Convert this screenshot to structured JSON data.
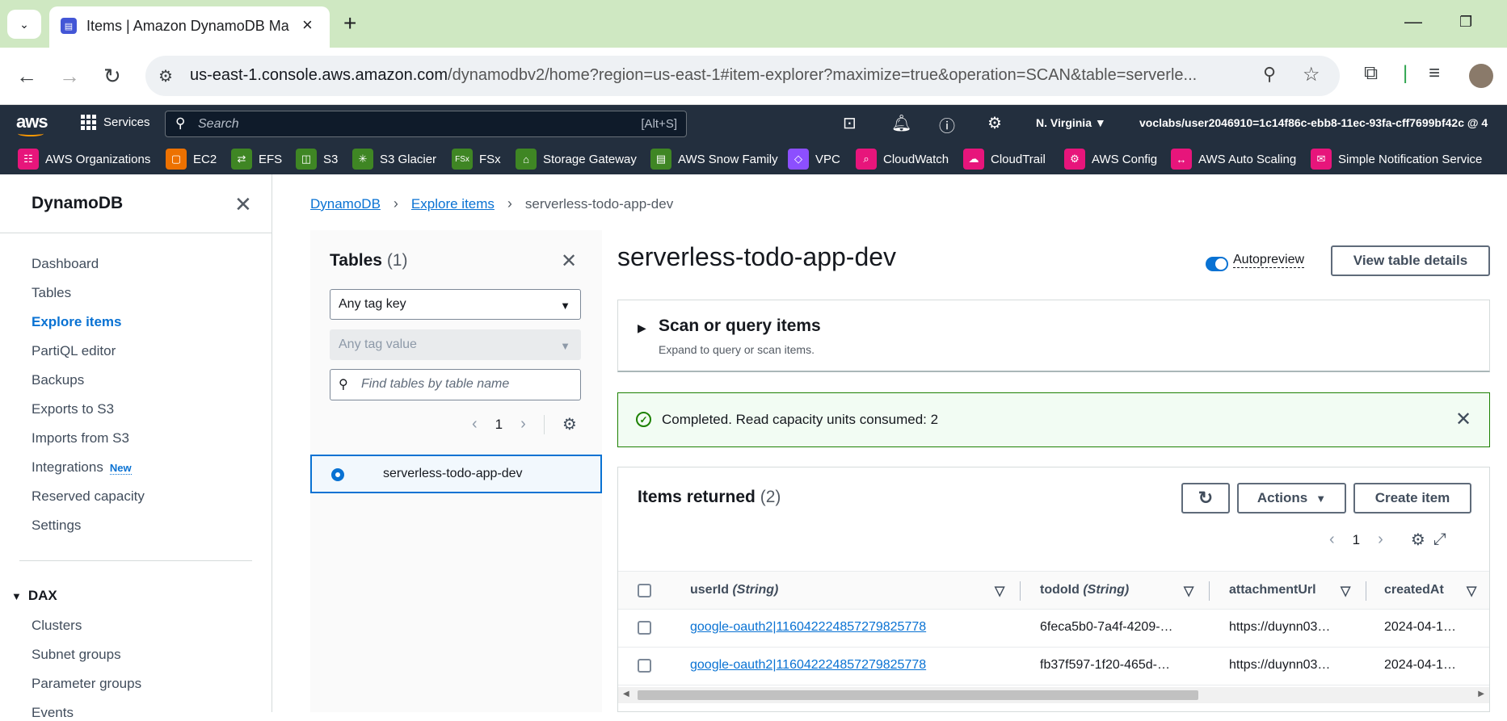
{
  "browser": {
    "tab_title": "Items | Amazon DynamoDB Ma",
    "url_host": "us-east-1.console.aws.amazon.com",
    "url_path": "/dynamodbv2/home?region=us-east-1#item-explorer?maximize=true&operation=SCAN&table=serverle..."
  },
  "aws_nav": {
    "services_label": "Services",
    "search_placeholder": "Search",
    "search_shortcut": "[Alt+S]",
    "region": "N. Virginia ▼",
    "account": "voclabs/user2046910=1c14f86c-ebb8-11ec-93fa-cff7699bf42c @ 4"
  },
  "favorites": [
    {
      "label": "AWS Organizations",
      "color": "#e7157b",
      "icon": "organizations-icon"
    },
    {
      "label": "EC2",
      "color": "#ed7100",
      "icon": "ec2-icon"
    },
    {
      "label": "EFS",
      "color": "#3f8624",
      "icon": "efs-icon"
    },
    {
      "label": "S3",
      "color": "#3f8624",
      "icon": "s3-icon"
    },
    {
      "label": "S3 Glacier",
      "color": "#3f8624",
      "icon": "glacier-icon"
    },
    {
      "label": "FSx",
      "color": "#3f8624",
      "icon": "fsx-icon"
    },
    {
      "label": "Storage Gateway",
      "color": "#3f8624",
      "icon": "storage-gateway-icon"
    },
    {
      "label": "AWS Snow Family",
      "color": "#3f8624",
      "icon": "snow-family-icon"
    },
    {
      "label": "VPC",
      "color": "#8c4fff",
      "icon": "vpc-icon"
    },
    {
      "label": "CloudWatch",
      "color": "#e7157b",
      "icon": "cloudwatch-icon"
    },
    {
      "label": "CloudTrail",
      "color": "#e7157b",
      "icon": "cloudtrail-icon"
    },
    {
      "label": "AWS Config",
      "color": "#e7157b",
      "icon": "config-icon"
    },
    {
      "label": "AWS Auto Scaling",
      "color": "#e7157b",
      "icon": "auto-scaling-icon"
    },
    {
      "label": "Simple Notification Service",
      "color": "#e7157b",
      "icon": "sns-icon"
    }
  ],
  "sidebar": {
    "title": "DynamoDB",
    "items": [
      "Dashboard",
      "Tables",
      "Explore items",
      "PartiQL editor",
      "Backups",
      "Exports to S3",
      "Imports from S3",
      "Integrations",
      "Reserved capacity",
      "Settings"
    ],
    "new_badge": "New",
    "dax_title": "DAX",
    "dax_items": [
      "Clusters",
      "Subnet groups",
      "Parameter groups",
      "Events"
    ]
  },
  "breadcrumb": {
    "items": [
      "DynamoDB",
      "Explore items",
      "serverless-todo-app-dev"
    ]
  },
  "tables_panel": {
    "title": "Tables",
    "count": "(1)",
    "tag_key": "Any tag key",
    "tag_value": "Any tag value",
    "find_placeholder": "Find tables by table name",
    "page": "1",
    "selected_table": "serverless-todo-app-dev"
  },
  "main": {
    "title": "serverless-todo-app-dev",
    "autopreview": "Autopreview",
    "view_details": "View table details",
    "scan_title": "Scan or query items",
    "scan_sub": "Expand to query or scan items.",
    "flash": "Completed. Read capacity units consumed: 2"
  },
  "items": {
    "title": "Items returned",
    "count": "(2)",
    "actions": "Actions",
    "create": "Create item",
    "page": "1",
    "columns": [
      {
        "name": "userId",
        "type": "(String)"
      },
      {
        "name": "todoId",
        "type": "(String)"
      },
      {
        "name": "attachmentUrl",
        "type": ""
      },
      {
        "name": "createdAt",
        "type": ""
      }
    ],
    "rows": [
      [
        "google-oauth2|116042224857279825778",
        "6feca5b0-7a4f-4209-…",
        "https://duynn03…",
        "2024-04-1…"
      ],
      [
        "google-oauth2|116042224857279825778",
        "fb37f597-1f20-465d-…",
        "https://duynn03…",
        "2024-04-1…"
      ]
    ]
  }
}
